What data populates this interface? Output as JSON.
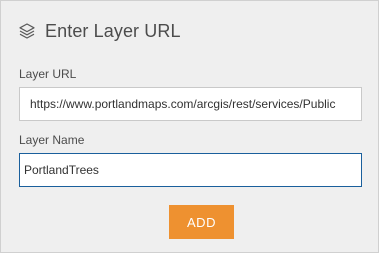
{
  "dialog": {
    "title": "Enter Layer URL",
    "icon": "layers-icon"
  },
  "form": {
    "url_label": "Layer URL",
    "url_value": "https://www.portlandmaps.com/arcgis/rest/services/Public",
    "name_label": "Layer Name",
    "name_value": "PortlandTrees",
    "add_label": "ADD"
  },
  "colors": {
    "panel_bg": "#efefef",
    "accent_button": "#ee9130",
    "focus_border": "#1a5f9c",
    "text": "#4c4c4c"
  }
}
